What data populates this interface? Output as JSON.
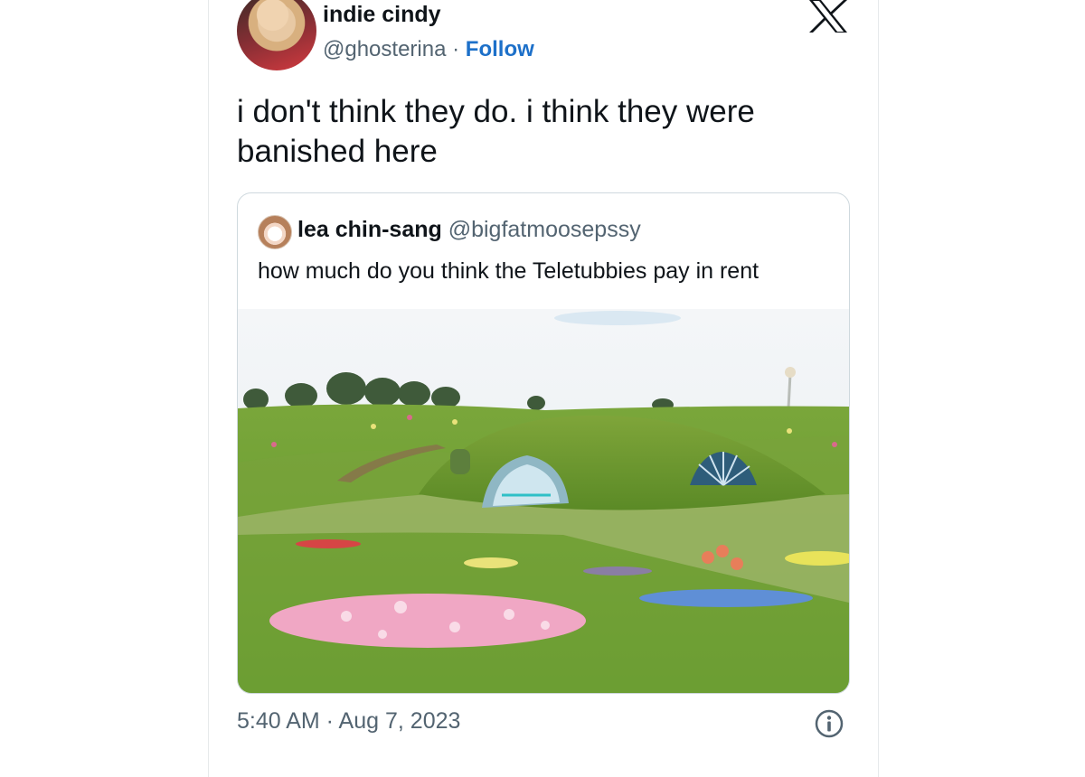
{
  "author": {
    "display_name": "indie cindy",
    "handle": "@ghosterina",
    "separator": " · ",
    "follow_label": "Follow"
  },
  "brand": {
    "logo_icon": "x-logo-icon"
  },
  "tweet": {
    "text": "i don't think they do. i think they were banished here",
    "timestamp": "5:40 AM · Aug 7, 2023"
  },
  "quoted_tweet": {
    "display_name": "lea chin-sang",
    "handle": "@bigfatmoosepssy",
    "text": "how much do you think the Teletubbies pay in rent",
    "photo_icon": "teletubbies-house-photo"
  },
  "colors": {
    "text": "#0f1419",
    "secondary": "#536471",
    "follow": "#1d70c9",
    "border": "#cfd9de"
  },
  "icons": {
    "info": "info-icon"
  }
}
